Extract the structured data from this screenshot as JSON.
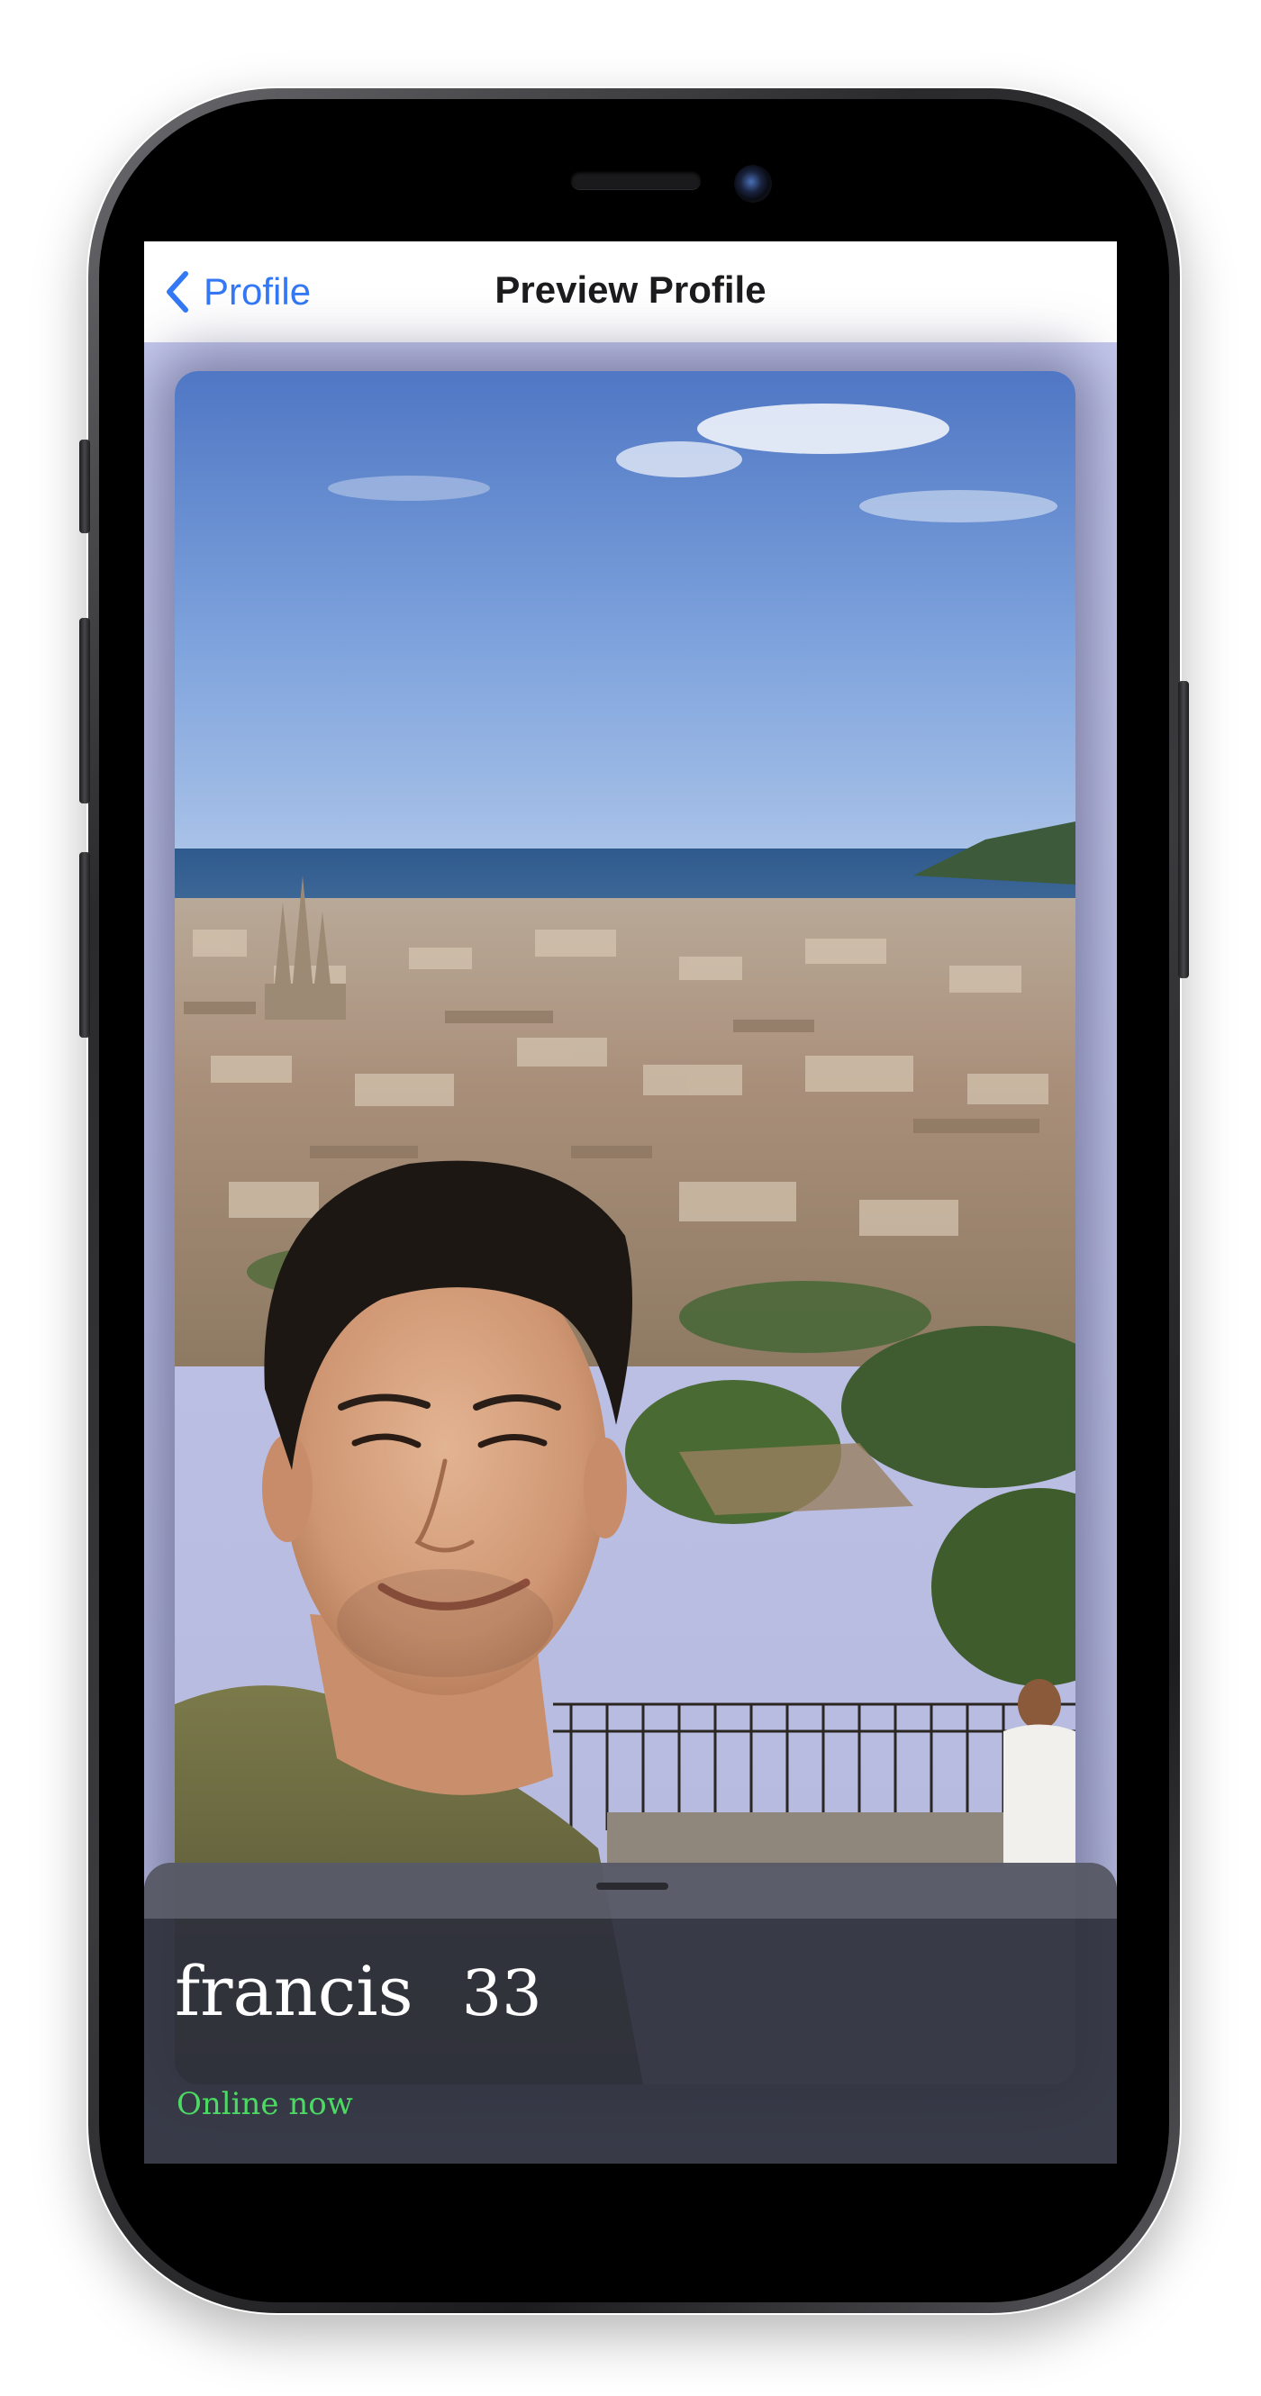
{
  "navbar": {
    "back_label": "Profile",
    "title": "Preview Profile"
  },
  "profile": {
    "name": "francis",
    "age": "33",
    "status": "Online now"
  },
  "colors": {
    "accent": "#3478f6",
    "online": "#4cd964",
    "sheet": "#2e303c"
  },
  "icons": {
    "back": "chevron-left-icon",
    "grabber": "grabber-handle-icon"
  }
}
